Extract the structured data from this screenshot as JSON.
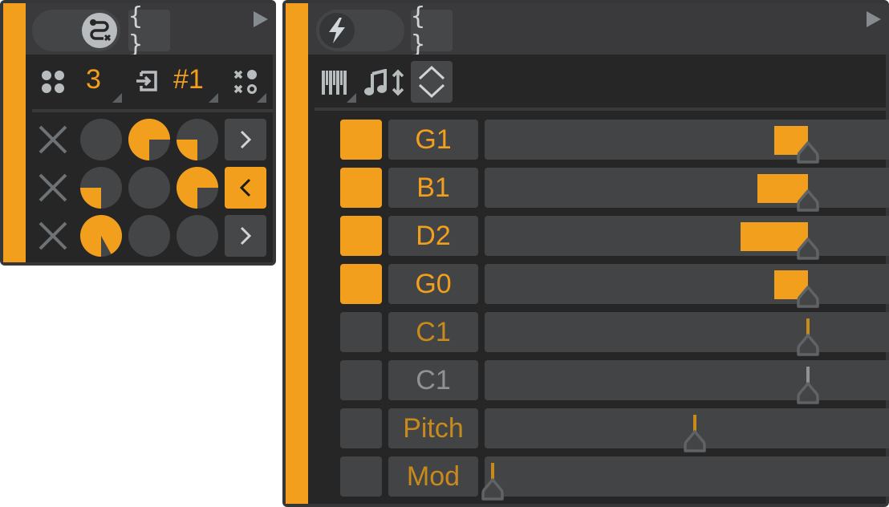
{
  "colors": {
    "accent": "#f29f1d",
    "accent_dim": "#c98a1c",
    "muted_text": "#8f9395",
    "icon": "#b7bcbf"
  },
  "left_panel": {
    "header": {
      "toggle_icon": "route-off-icon",
      "toggle_state": "on",
      "code_button_label": "{ }",
      "expand_icon": "play-triangle-icon"
    },
    "toolbar": {
      "grid_icon": "four-dots-icon",
      "count_value": "3",
      "input_icon": "input-arrow-icon",
      "slot_value": "#1",
      "pattern_icon": "x-o-pattern-icon"
    },
    "grid_rows": [
      {
        "clear_icon": "x-icon",
        "pies": [
          0,
          0.75,
          0.25
        ],
        "nav": {
          "icon": "chevron-right-icon",
          "active": false
        }
      },
      {
        "clear_icon": "x-icon",
        "pies": [
          0.25,
          0,
          0.75
        ],
        "nav": {
          "icon": "chevron-left-icon",
          "active": true
        }
      },
      {
        "clear_icon": "x-icon",
        "pies": [
          0.92,
          0,
          0
        ],
        "nav": {
          "icon": "chevron-right-icon",
          "active": false
        }
      }
    ]
  },
  "right_panel": {
    "header": {
      "toggle_icon": "lightning-icon",
      "toggle_state": "off",
      "code_button_label": "{ }",
      "expand_icon": "play-triangle-icon"
    },
    "toolbar": {
      "keyboard_icon": "piano-keys-icon",
      "note_icon": "music-note-updown-icon",
      "range_icon": "up-down-chevrons-icon"
    },
    "rows": [
      {
        "label": "G1",
        "enabled": true,
        "value": 0.78,
        "bar_width": 0.08,
        "label_color": "accent",
        "stem_color": null
      },
      {
        "label": "B1",
        "enabled": true,
        "value": 0.78,
        "bar_width": 0.12,
        "label_color": "accent",
        "stem_color": null
      },
      {
        "label": "D2",
        "enabled": true,
        "value": 0.78,
        "bar_width": 0.16,
        "label_color": "accent",
        "stem_color": null
      },
      {
        "label": "G0",
        "enabled": true,
        "value": 0.78,
        "bar_width": 0.08,
        "label_color": "accent",
        "stem_color": null
      },
      {
        "label": "C1",
        "enabled": false,
        "value": 0.78,
        "bar_width": 0,
        "label_color": "accent_dim",
        "stem_color": "accent_dim"
      },
      {
        "label": "C1",
        "enabled": false,
        "value": 0.78,
        "bar_width": 0,
        "label_color": "muted",
        "stem_color": "muted"
      },
      {
        "label": "Pitch",
        "enabled": false,
        "value": 0.5,
        "bar_width": 0,
        "label_color": "accent_dim",
        "stem_color": "accent_dim"
      },
      {
        "label": "Mod",
        "enabled": false,
        "value": 0.0,
        "bar_width": 0,
        "label_color": "accent_dim",
        "stem_color": "accent_dim"
      }
    ]
  }
}
